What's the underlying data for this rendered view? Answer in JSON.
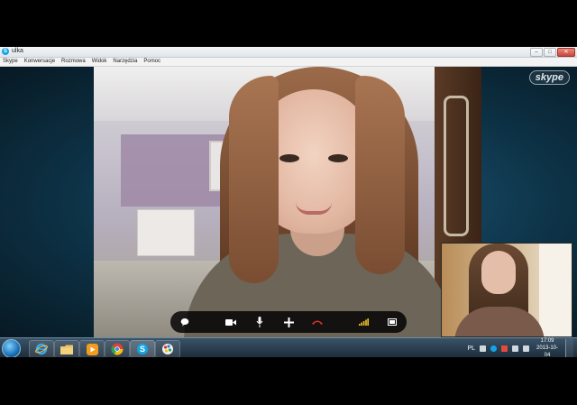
{
  "window": {
    "title": "ulka"
  },
  "menu": {
    "items": [
      "Skype",
      "Konwersacje",
      "Rozmowa",
      "Widok",
      "Narzędzia",
      "Pomoc"
    ]
  },
  "branding": {
    "logo_text": "skype"
  },
  "call_controls": {
    "buttons": [
      {
        "name": "chat-toggle",
        "icon": "chat-bubble-icon"
      },
      {
        "name": "video-toggle",
        "icon": "video-camera-icon"
      },
      {
        "name": "mute-toggle",
        "icon": "microphone-icon"
      },
      {
        "name": "add-participant",
        "icon": "plus-icon"
      },
      {
        "name": "end-call",
        "icon": "hang-up-icon"
      },
      {
        "name": "call-quality",
        "icon": "signal-bars-icon"
      },
      {
        "name": "fullscreen-toggle",
        "icon": "fullscreen-icon"
      }
    ],
    "end_call_color": "#e0302a"
  },
  "taskbar": {
    "apps": [
      {
        "name": "internet-explorer",
        "icon": "internet-explorer-icon"
      },
      {
        "name": "file-explorer",
        "icon": "folder-icon"
      },
      {
        "name": "media-player",
        "icon": "media-player-icon"
      },
      {
        "name": "chrome",
        "icon": "chrome-icon"
      },
      {
        "name": "skype",
        "icon": "skype-icon"
      },
      {
        "name": "paint",
        "icon": "paint-icon"
      }
    ],
    "language": "PL",
    "time": "17:09",
    "date": "2013-10-04"
  }
}
